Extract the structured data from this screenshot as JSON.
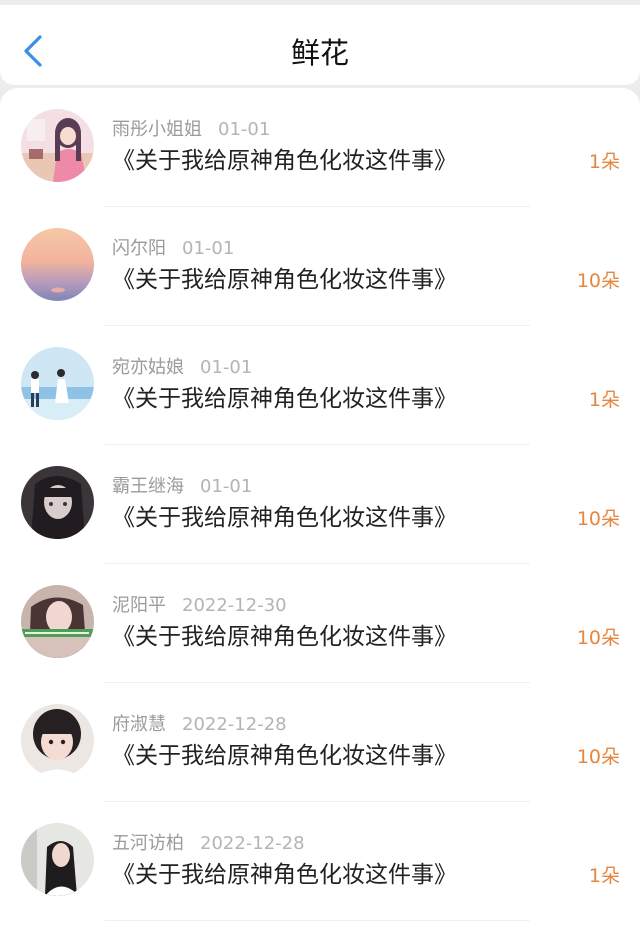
{
  "header": {
    "title": "鲜花",
    "back_icon": "chevron-left-icon",
    "accent": "#3a8ee6"
  },
  "flower_color": "#e6863f",
  "items": [
    {
      "name": "雨彤小姐姐",
      "date": "01-01",
      "work": "《关于我给原神角色化妆这件事》",
      "count": "1朵"
    },
    {
      "name": "闪尔阳",
      "date": "01-01",
      "work": "《关于我给原神角色化妆这件事》",
      "count": "10朵"
    },
    {
      "name": "宛亦姑娘",
      "date": "01-01",
      "work": "《关于我给原神角色化妆这件事》",
      "count": "1朵"
    },
    {
      "name": "霸王继海",
      "date": "01-01",
      "work": "《关于我给原神角色化妆这件事》",
      "count": "10朵"
    },
    {
      "name": "泥阳平",
      "date": "2022-12-30",
      "work": "《关于我给原神角色化妆这件事》",
      "count": "10朵"
    },
    {
      "name": "府淑慧",
      "date": "2022-12-28",
      "work": "《关于我给原神角色化妆这件事》",
      "count": "10朵"
    },
    {
      "name": "五河访柏",
      "date": "2022-12-28",
      "work": "《关于我给原神角色化妆这件事》",
      "count": "1朵"
    }
  ]
}
